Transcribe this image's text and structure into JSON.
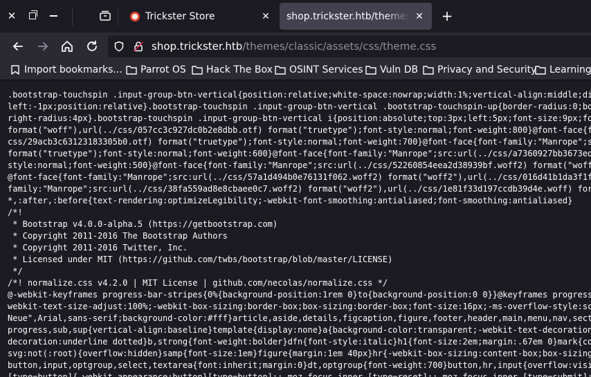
{
  "tabs": [
    {
      "title": "Trickster Store"
    },
    {
      "title": "shop.trickster.htb/themes/classic/assets/css/theme.css"
    }
  ],
  "nav": {
    "url_host": "shop.trickster.htb",
    "url_path": "/themes/classic/assets/css/theme.css"
  },
  "bookmarks": [
    {
      "label": "Import bookmarks...",
      "icon": "import-icon"
    },
    {
      "label": "Parrot OS",
      "icon": "folder-icon"
    },
    {
      "label": "Hack The Box",
      "icon": "folder-icon"
    },
    {
      "label": "OSINT Services",
      "icon": "folder-icon"
    },
    {
      "label": "Vuln DB",
      "icon": "folder-icon"
    },
    {
      "label": "Privacy and Security",
      "icon": "folder-icon"
    },
    {
      "label": "Learning",
      "icon": "folder-icon"
    }
  ],
  "code_lines": [
    ".bootstrap-touchspin .input-group-btn-vertical{position:relative;white-space:nowrap;width:1%;vertical-align:middle;di",
    "left:-1px;position:relative}.bootstrap-touchspin .input-group-btn-vertical .bootstrap-touchspin-up{border-radius:0;bo",
    "right-radius:4px}.bootstrap-touchspin .input-group-btn-vertical i{position:absolute;top:3px;left:5px;font-size:9px;fo",
    "format(\"woff\"),url(../css/057cc3c927dc0b2e8dbb.otf) format(\"truetype\");font-style:normal;font-weight:800}@font-face{f",
    "css/29acb3c63123183305b0.otf) format(\"truetype\");font-style:normal;font-weight:700}@font-face{font-family:\"Manrope\";s",
    "format(\"truetype\");font-style:normal;font-weight:600}@font-face{font-family:\"Manrope\";src:url(../css/a7360927bb3673ed",
    "style:normal;font-weight:500}@font-face{font-family:\"Manrope\";src:url(../css/52260854eea2d38939bf.woff2) format(\"woff",
    "@font-face{font-family:\"Manrope\";src:url(../css/57a1d494b0e76131f062.woff2) format(\"woff2\"),url(../css/016d41b1da3f1f",
    "family:\"Manrope\";src:url(../css/38fa559ad8e8cbaee0c7.woff2) format(\"woff2\"),url(../css/1e81f33d197ccdb39d4e.woff) for",
    "*,:after,:before{text-rendering:optimizeLegibility;-webkit-font-smoothing:antialiased;font-smoothing:antialiased}",
    "/*!",
    " * Bootstrap v4.0.0-alpha.5 (https://getbootstrap.com)",
    " * Copyright 2011-2016 The Bootstrap Authors",
    " * Copyright 2011-2016 Twitter, Inc.",
    " * Licensed under MIT (https://github.com/twbs/bootstrap/blob/master/LICENSE)",
    " */",
    "/*! normalize.css v4.2.0 | MIT License | github.com/necolas/normalize.css */",
    "@-webkit-keyframes progress-bar-stripes{0%{background-position:1rem 0}to{background-position:0 0}}@keyframes progress",
    "webkit-text-size-adjust:100%;-webkit-box-sizing:border-box;box-sizing:border-box;font-size:16px;-ms-overflow-style:sc",
    "Neue\",Arial,sans-serif;background-color:#fff}article,aside,details,figcaption,figure,footer,header,main,menu,nav,sect",
    "progress,sub,sup{vertical-align:baseline}template{display:none}a{background-color:transparent;-webkit-text-decoration",
    "decoration:underline dotted}b,strong{font-weight:bolder}dfn{font-style:italic}h1{font-size:2em;margin:.67em 0}mark{co",
    "svg:not(:root){overflow:hidden}samp{font-size:1em}figure{margin:1em 40px}hr{-webkit-box-sizing:content-box;box-sizing",
    "button,input,optgroup,select,textarea{font:inherit;margin:0}dt,optgroup{font-weight:700}button,hr,input{overflow:visi",
    "[type=button]{-webkit-appearance:button}[type=button]::-moz-focus-inner,[type=reset]::-moz-focus-inner,[type=submit]:"
  ]
}
